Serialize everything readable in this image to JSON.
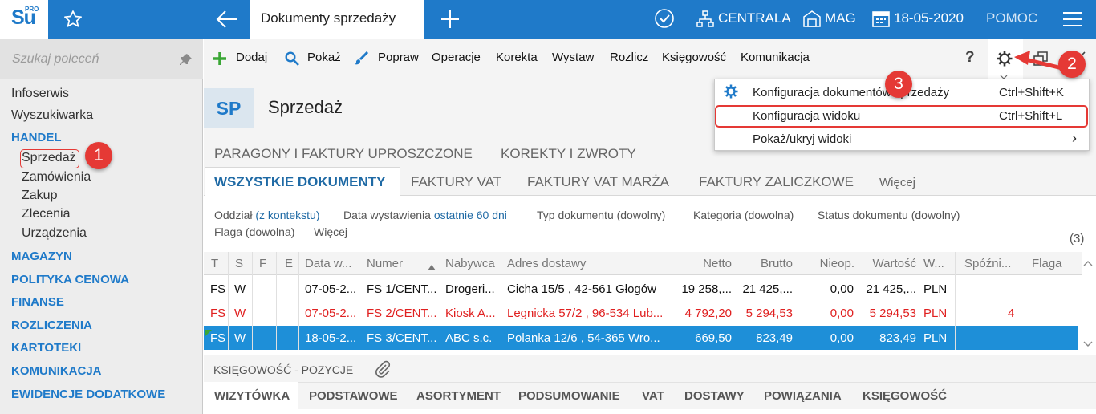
{
  "app": {
    "logo_main": "Su",
    "logo_sup": "PRO"
  },
  "topbar": {
    "tab_title": "Dokumenty sprzedaży",
    "company": "CENTRALA",
    "warehouse": "MAG",
    "date": "18-05-2020",
    "help": "POMOC",
    "icons": [
      "star-icon",
      "arrow-left-icon",
      "plus-icon",
      "check-circle-icon",
      "sitemap-icon",
      "warehouse-icon",
      "calendar-icon",
      "hamburger-icon"
    ]
  },
  "sidebar": {
    "search_placeholder": "Szukaj poleceń",
    "items": [
      {
        "label": "Infoserwis"
      },
      {
        "label": "Wyszukiwarka"
      },
      {
        "label": "HANDEL"
      },
      {
        "label": "Sprzedaż"
      },
      {
        "label": "Zamówienia"
      },
      {
        "label": "Zakup"
      },
      {
        "label": "Zlecenia"
      },
      {
        "label": "Urządzenia"
      },
      {
        "label": "MAGAZYN"
      },
      {
        "label": "POLITYKA CENOWA"
      },
      {
        "label": "FINANSE"
      },
      {
        "label": "ROZLICZENIA"
      },
      {
        "label": "KARTOTEKI"
      },
      {
        "label": "KOMUNIKACJA"
      },
      {
        "label": "EWIDENCJE DODATKOWE"
      }
    ]
  },
  "toolbar": {
    "buttons": [
      "Dodaj",
      "Pokaż",
      "Popraw",
      "Operacje",
      "Korekta",
      "Wystaw",
      "Rozlicz",
      "Księgowość",
      "Komunikacja"
    ],
    "help": "?"
  },
  "page": {
    "badge": "SP",
    "title": "Sprzedaż"
  },
  "tabs_top": [
    "PARAGONY I FAKTURY UPROSZCZONE",
    "KOREKTY I ZWROTY"
  ],
  "tabs_main": [
    "WSZYSTKIE DOKUMENTY",
    "FAKTURY VAT",
    "FAKTURY VAT MARŻA",
    "FAKTURY ZALICZKOWE",
    "Więcej"
  ],
  "filters": {
    "oddzial_label": "Oddział",
    "oddzial_value": "(z kontekstu)",
    "data_label": "Data wystawienia",
    "data_value": "ostatnie 60 dni",
    "typ": "Typ dokumentu (dowolny)",
    "kategoria": "Kategoria (dowolna)",
    "status": "Status dokumentu (dowolny)",
    "flaga": "Flaga (dowolna)",
    "wiecej": "Więcej",
    "count": "(3)"
  },
  "table": {
    "columns": [
      "T",
      "S",
      "F",
      "E",
      "Data w...",
      "Numer",
      "Nabywca",
      "Adres dostawy",
      "Netto",
      "Brutto",
      "Nieop.",
      "Wartość",
      "W...",
      "Spóźni...",
      "Flaga"
    ],
    "rows": [
      {
        "t": "FS",
        "s": "W",
        "data": "07-05-2...",
        "numer": "FS 1/CENT...",
        "nabywca": "Drogeri...",
        "adres": "Cicha  15/5 , 42-561 Głogów",
        "netto": "19 258,...",
        "brutto": "21 425,...",
        "nieop": "0,00",
        "wartosc": "21 425,...",
        "w": "PLN",
        "spozn": ""
      },
      {
        "t": "FS",
        "s": "W",
        "data": "07-05-2...",
        "numer": "FS 2/CENT...",
        "nabywca": "Kiosk A...",
        "adres": "Legnicka  57/2 , 96-534 Lub...",
        "netto": "4 792,20",
        "brutto": "5 294,53",
        "nieop": "0,00",
        "wartosc": "5 294,53",
        "w": "PLN",
        "spozn": "4"
      },
      {
        "t": "FS",
        "s": "W",
        "data": "18-05-2...",
        "numer": "FS 3/CENT...",
        "nabywca": "ABC s.c.",
        "adres": "Polanka  12/6 , 54-365 Wro...",
        "netto": "669,50",
        "brutto": "823,49",
        "nieop": "0,00",
        "wartosc": "823,49",
        "w": "PLN",
        "spozn": ""
      }
    ]
  },
  "bottom": {
    "header": "KSIĘGOWOŚĆ - POZYCJE",
    "tabs": [
      "WIZYTÓWKA",
      "PODSTAWOWE",
      "ASORTYMENT",
      "PODSUMOWANIE",
      "VAT",
      "DOSTAWY",
      "POWIĄZANIA",
      "KSIĘGOWOŚĆ"
    ]
  },
  "menu": {
    "items": [
      {
        "label": "Konfiguracja dokumentów sprzedaży",
        "shortcut": "Ctrl+Shift+K"
      },
      {
        "label": "Konfiguracja widoku",
        "shortcut": "Ctrl+Shift+L"
      },
      {
        "label": "Pokaż/ukryj widoki",
        "shortcut": "›"
      }
    ]
  },
  "annotations": [
    "1",
    "2",
    "3"
  ],
  "colors": {
    "brand": "#1f7ac9",
    "selected_row": "#1e8fd8",
    "red_text": "#e02020",
    "callout": "#e53935"
  }
}
